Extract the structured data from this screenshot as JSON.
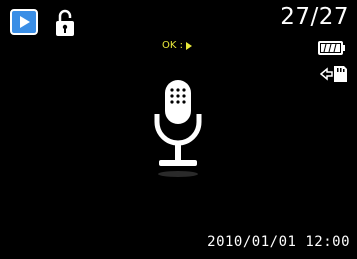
{
  "status_bar": {
    "counter": "27/27"
  },
  "hint": {
    "text": "OK :"
  },
  "footer": {
    "datetime": "2010/01/01  12:00"
  },
  "icons": {
    "mode": "playback-icon",
    "protect": "lock-icon",
    "battery": "battery-full-icon",
    "storage": "memory-card-icon",
    "center": "microphone-icon"
  },
  "colors": {
    "background": "#000000",
    "accent_blue": "#3a8ee6",
    "hint_yellow": "#e8e83a",
    "text": "#ffffff"
  }
}
